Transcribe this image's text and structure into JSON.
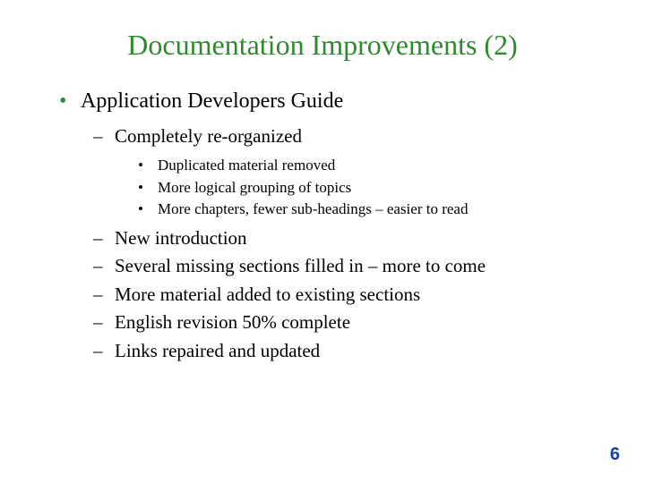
{
  "title": "Documentation Improvements (2)",
  "bullets_lvl1": [
    {
      "text": "Application Developers Guide"
    }
  ],
  "bullets_lvl2_first": [
    {
      "text": "Completely re-organized"
    }
  ],
  "bullets_lvl3": [
    {
      "text": "Duplicated material removed"
    },
    {
      "text": "More logical grouping of topics"
    },
    {
      "text": "More chapters, fewer sub-headings – easier to read"
    }
  ],
  "bullets_lvl2_rest": [
    {
      "text": "New introduction"
    },
    {
      "text": "Several missing sections filled in – more to come"
    },
    {
      "text": "More material added to existing sections"
    },
    {
      "text": "English revision 50% complete"
    },
    {
      "text": "Links repaired and updated"
    }
  ],
  "glyphs": {
    "dot": "•",
    "dash": "–"
  },
  "page_number": "6"
}
